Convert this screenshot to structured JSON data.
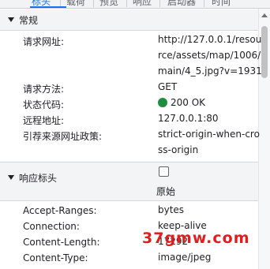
{
  "tabs": [
    {
      "label": "标头",
      "active": true
    },
    {
      "label": "载荷",
      "active": false
    },
    {
      "label": "预览",
      "active": false
    },
    {
      "label": "响应",
      "active": false
    },
    {
      "label": "启动器",
      "active": false
    },
    {
      "label": "时间",
      "active": false
    }
  ],
  "general": {
    "title": "常规",
    "rows": [
      {
        "label": "请求网址:",
        "lines": [
          "http://127.0.0.1/resou",
          "rce/assets/map/1006/",
          "main/4_5.jpg?v=1931"
        ]
      },
      {
        "label": "请求方法:",
        "lines": [
          "GET"
        ]
      },
      {
        "label": "状态代码:",
        "lines": [
          "200 OK"
        ],
        "status_color": "#1e8e3e"
      },
      {
        "label": "远程地址:",
        "lines": [
          "127.0.0.1:80"
        ]
      },
      {
        "label": "引荐来源网址政策:",
        "lines": [
          "strict-origin-when-cro",
          "ss-origin"
        ]
      }
    ]
  },
  "response_headers": {
    "title": "响应标头",
    "raw_label": "原始",
    "raw_checked": false,
    "rows": [
      {
        "label": "Accept-Ranges:",
        "value": "bytes"
      },
      {
        "label": "Connection:",
        "value": "keep-alive"
      },
      {
        "label": "Content-Length:",
        "value": "17292"
      },
      {
        "label": "Content-Type:",
        "value": "image/jpeg"
      }
    ]
  },
  "watermark": "37gmw.com"
}
